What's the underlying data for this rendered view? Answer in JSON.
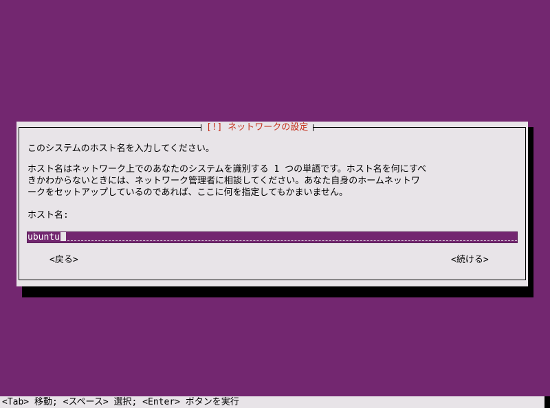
{
  "dialog": {
    "title": "[!] ネットワークの設定",
    "prompt": "このシステムのホスト名を入力してください。",
    "description_lines": [
      "ホスト名はネットワーク上でのあなたのシステムを識別する 1 つの単語です。ホスト名を何にすべ",
      "きかわからないときには、ネットワーク管理者に相談してください。あなた自身のホームネットワ",
      "ークをセットアップしているのであれば、ここに何を指定してもかまいません。"
    ],
    "hostname_label": "ホスト名:",
    "hostname_value": "ubuntu",
    "back_label": "<戻る>",
    "continue_label": "<続ける>"
  },
  "status_bar": {
    "text": "<Tab> 移動; <スペース> 選択; <Enter> ボタンを実行"
  },
  "colors": {
    "background": "#732770",
    "dialog": "#e8e4e8",
    "title": "#c4301c",
    "input_bg": "#732770",
    "shadow": "#000000"
  }
}
